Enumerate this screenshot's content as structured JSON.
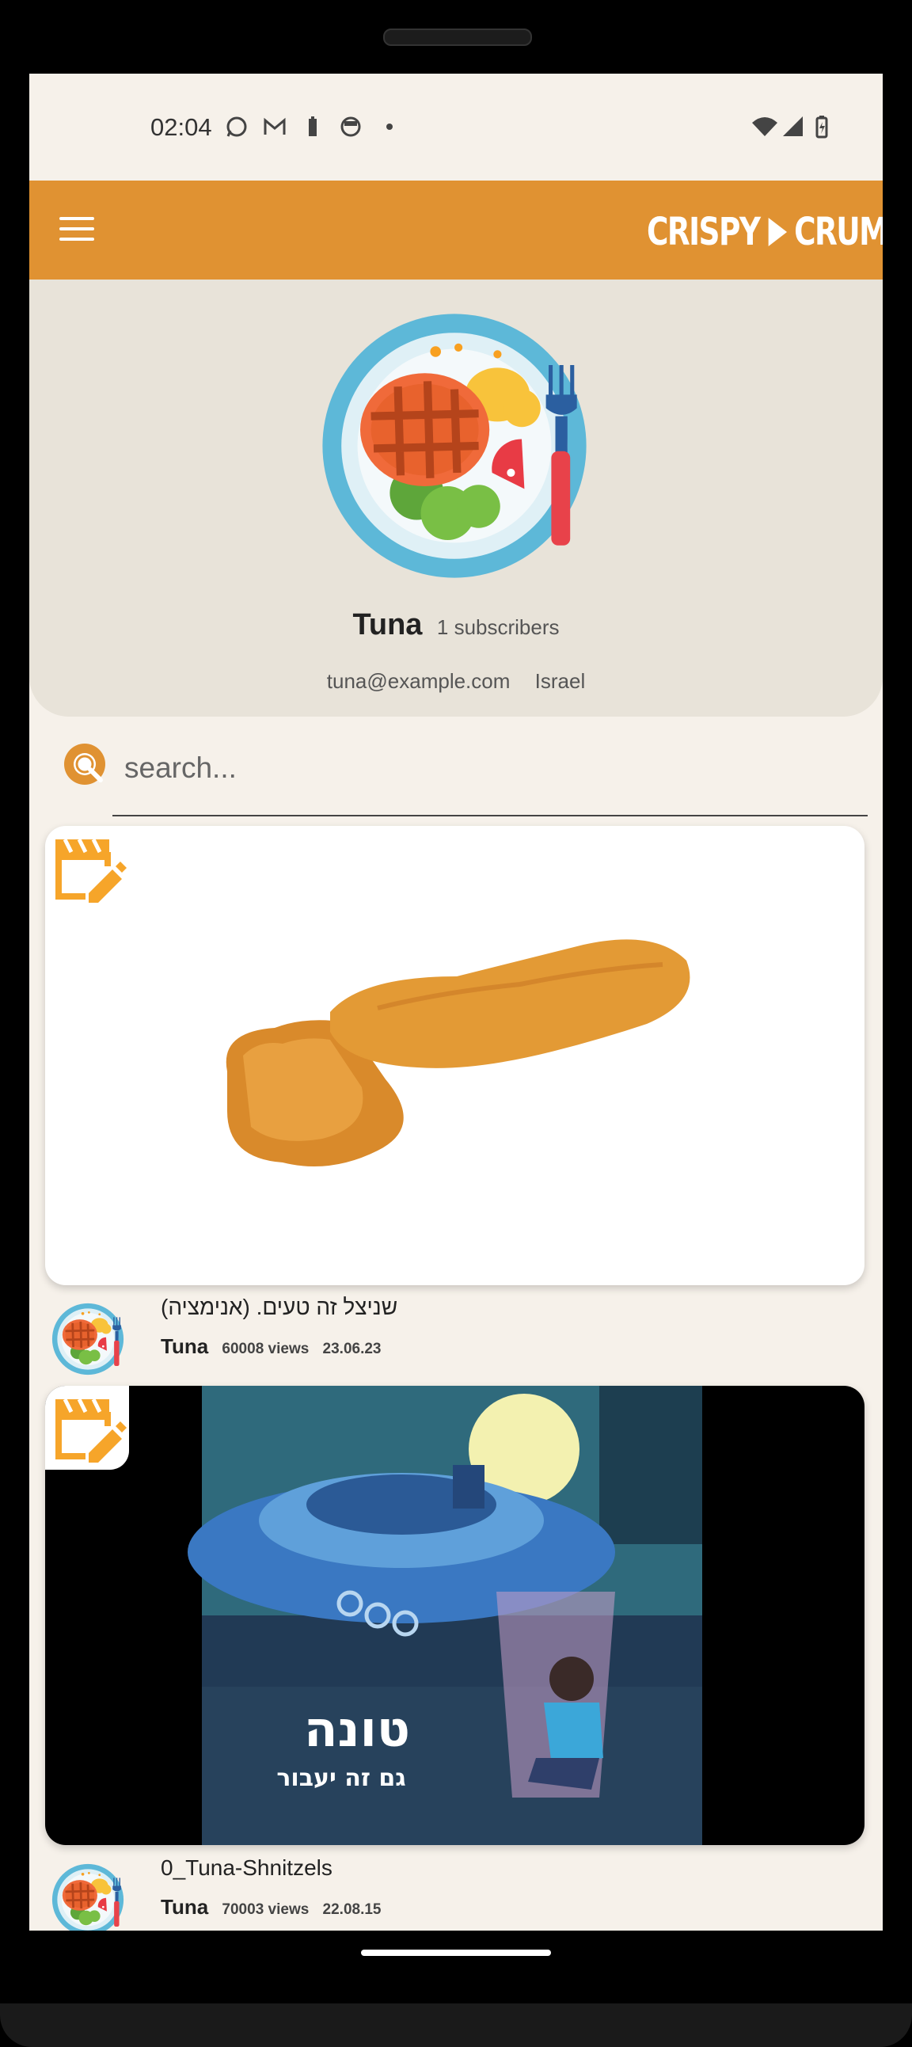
{
  "status_bar": {
    "time": "02:04",
    "left_icons": [
      "whatsapp-icon",
      "gmail-icon",
      "battery-saver-icon",
      "face-icon",
      "dot-icon"
    ],
    "right_icons": [
      "wifi-icon",
      "cellular-signal-icon",
      "battery-icon"
    ]
  },
  "app_bar": {
    "logo_left": "CRISPY",
    "logo_right": "CRUMBS",
    "menu_icon": "hamburger-menu-icon",
    "color": "#e09232"
  },
  "profile": {
    "name": "Tuna",
    "subscribers": "1 subscribers",
    "email": "tuna@example.com",
    "country": "Israel"
  },
  "search": {
    "placeholder": "search..."
  },
  "videos": [
    {
      "title": "שניצל זה טעים. (אנימציה)",
      "channel": "Tuna",
      "views": "60008 views",
      "date": "23.06.23"
    },
    {
      "title": "0_Tuna-Shnitzels",
      "channel": "Tuna",
      "views": "70003 views",
      "date": "22.08.15",
      "thumbnail_text_main": "טונה",
      "thumbnail_text_sub": "גם זה יעבור"
    }
  ],
  "colors": {
    "accent": "#e09232",
    "edit_icon": "#f6a52a",
    "background": "#f6f1ea",
    "profile_panel": "#e8e3d9"
  }
}
